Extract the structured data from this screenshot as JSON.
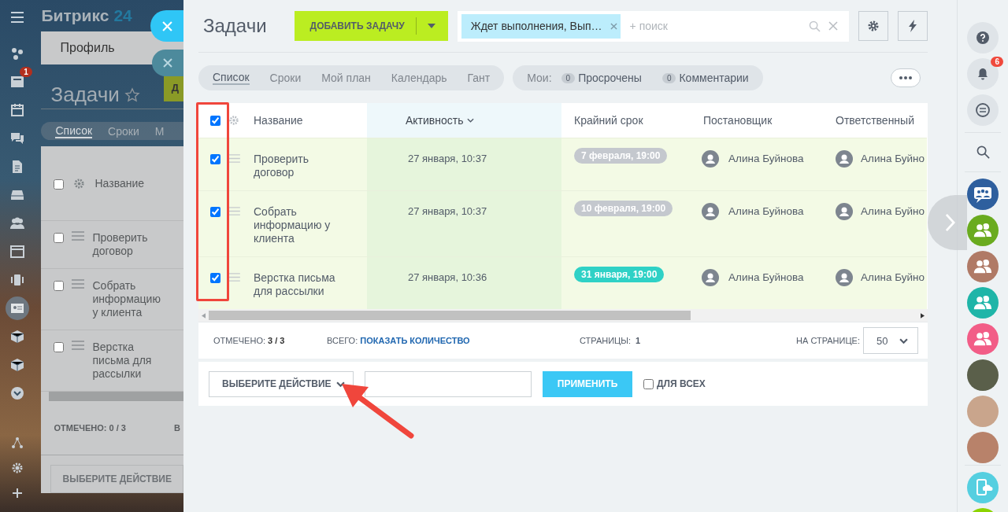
{
  "background_page": {
    "logo": "Битрикс",
    "logo_number": "24",
    "tab": "Профиль",
    "title": "Задачи",
    "add_fragment": "Д",
    "views": [
      {
        "label": "Список",
        "selected": true
      },
      {
        "label": "Сроки",
        "selected": false
      },
      {
        "label": "М",
        "selected": false
      }
    ],
    "header_checked": false,
    "column": "Название",
    "rows": [
      {
        "title": "Проверить договор",
        "checked": false
      },
      {
        "title": "Собрать информацию у клиента",
        "checked": false
      },
      {
        "title": "Верстка письма для рассылки",
        "checked": false
      }
    ],
    "checked_label": "ОТМЕЧЕНО:",
    "checked_value": "0 / 3",
    "total_fragment": "В",
    "action": "ВЫБЕРИТЕ ДЕЙСТВИЕ"
  },
  "left_nav": {
    "counter": "1"
  },
  "panel": {
    "title": "Задачи",
    "add_button": "ДОБАВИТЬ ЗАДАЧУ",
    "filter_tag": "Ждет выполнения, Вып…",
    "search": {
      "placeholder": "+ поиск"
    },
    "views": [
      {
        "label": "Список",
        "selected": true
      },
      {
        "label": "Сроки",
        "selected": false
      },
      {
        "label": "Мой план",
        "selected": false
      },
      {
        "label": "Календарь",
        "selected": false
      },
      {
        "label": "Гант",
        "selected": false
      }
    ],
    "my_label": "Мои:",
    "counters": [
      {
        "count": "0",
        "label": "Просрочены"
      },
      {
        "count": "0",
        "label": "Комментарии"
      }
    ],
    "table": {
      "header_checked": true,
      "columns": [
        {
          "label": "Название",
          "sorted": false
        },
        {
          "label": "Активность",
          "sorted": true
        },
        {
          "label": "Крайний срок",
          "sorted": false
        },
        {
          "label": "Постановщик",
          "sorted": false
        },
        {
          "label": "Ответственный",
          "sorted": false
        }
      ],
      "rows": [
        {
          "checked": true,
          "title": "Проверить договор",
          "activity": "27 января, 10:37",
          "deadline": "7 февраля, 19:00",
          "color": "#c4c8ce",
          "creator": "Алина Буйнова",
          "responsible": "Алина Буйно"
        },
        {
          "checked": true,
          "title": "Собрать информацию у клиента",
          "activity": "27 января, 10:37",
          "deadline": "10 февраля, 19:00",
          "color": "#c4c8ce",
          "creator": "Алина Буйнова",
          "responsible": "Алина Буйно"
        },
        {
          "checked": true,
          "title": "Верстка письма для рассылки",
          "activity": "27 января, 10:36",
          "deadline": "31 января, 19:00",
          "color": "#2fd1c6",
          "creator": "Алина Буйнова",
          "responsible": "Алина Буйно"
        }
      ]
    },
    "footer": {
      "checked_label": "ОТМЕЧЕНО:",
      "checked_value": "3 / 3",
      "total_label": "ВСЕГО:",
      "total_link": "ПОКАЗАТЬ КОЛИЧЕСТВО",
      "pages_label": "СТРАНИЦЫ:",
      "pages_value": "1",
      "per_page_label": "НА СТРАНИЦЕ:",
      "per_page": "50"
    },
    "actions": {
      "select": "ВЫБЕРИТЕ ДЕЙСТВИЕ",
      "apply": "ПРИМЕНИТЬ",
      "for_all": {
        "label": "ДЛЯ ВСЕХ",
        "checked": false
      }
    }
  },
  "right_bar": {
    "notifications": "6",
    "chats": [
      {
        "kind": "group",
        "color": "#2e5f9e"
      },
      {
        "kind": "team",
        "color": "#6aab1f"
      },
      {
        "kind": "team",
        "color": "#b07a66"
      },
      {
        "kind": "team",
        "color": "#1fb5a8"
      },
      {
        "kind": "team",
        "color": "#f25d87"
      },
      {
        "kind": "person",
        "color": "#5a5f4a"
      },
      {
        "kind": "person",
        "color": "#c9a58c"
      },
      {
        "kind": "person",
        "color": "#b8826a"
      }
    ]
  }
}
